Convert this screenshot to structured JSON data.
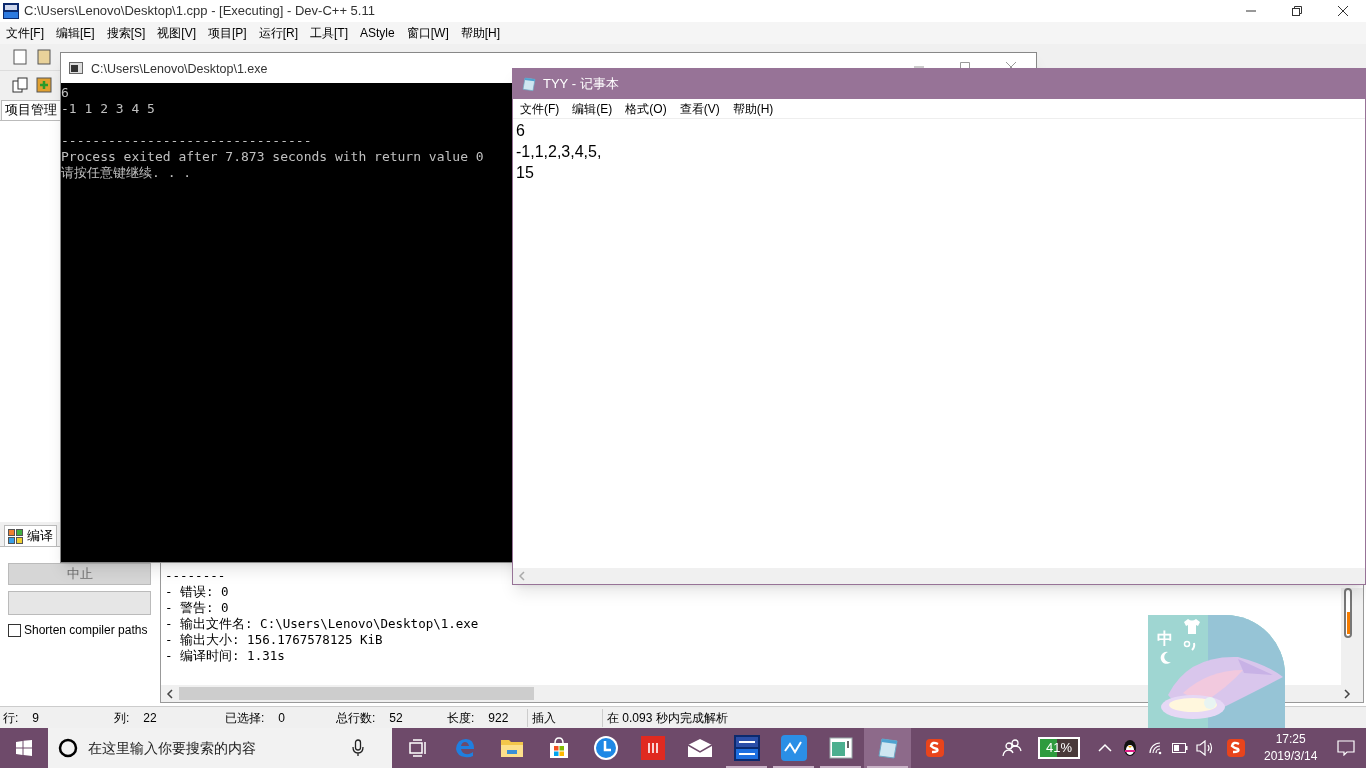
{
  "devcpp": {
    "title": "C:\\Users\\Lenovo\\Desktop\\1.cpp - [Executing] - Dev-C++ 5.11",
    "menu": [
      "文件[F]",
      "编辑[E]",
      "搜索[S]",
      "视图[V]",
      "项目[P]",
      "运行[R]",
      "工具[T]",
      "AStyle",
      "窗口[W]",
      "帮助[H]"
    ],
    "left_tab": "项目管理",
    "bottom_tab": "编译",
    "abort_button": {
      "label": "中止",
      "disabled": true
    },
    "progress": {
      "level": 0
    },
    "shorten_paths": {
      "label": "Shorten compiler paths",
      "checked": false
    },
    "log_lines": [
      "--------",
      "- 错误: 0",
      "- 警告: 0",
      "- 输出文件名: C:\\Users\\Lenovo\\Desktop\\1.exe",
      "- 输出大小: 156.1767578125 KiB",
      "- 编译时间: 1.31s"
    ],
    "status_fields": [
      {
        "label": "行:",
        "value": "9"
      },
      {
        "label": "列:",
        "value": "22"
      },
      {
        "label": "已选择:",
        "value": "0"
      },
      {
        "label": "总行数:",
        "value": "52"
      },
      {
        "label": "长度:",
        "value": "922"
      }
    ],
    "status_mode": "插入",
    "status_message": "在 0.093 秒内完成解析"
  },
  "console": {
    "title": "C:\\Users\\Lenovo\\Desktop\\1.exe",
    "output_lines": [
      "6",
      "-1 1 2 3 4 5"
    ],
    "footer_lines": [
      "--------------------------------",
      "Process exited after 7.873 seconds with return value 0",
      "请按任意键继续. . ."
    ]
  },
  "notepad": {
    "title": "TYY - 记事本",
    "menu": [
      "文件(F)",
      "编辑(E)",
      "格式(O)",
      "查看(V)",
      "帮助(H)"
    ],
    "lines": [
      "6",
      "-1,1,2,3,4,5,",
      "15"
    ]
  },
  "ime": {
    "mode": "中"
  },
  "taskbar": {
    "search_placeholder": "在这里输入你要搜索的内容",
    "apps": [
      {
        "kind": "taskview",
        "running": false,
        "selected": false
      },
      {
        "kind": "edge",
        "running": false,
        "selected": false
      },
      {
        "kind": "explorer",
        "running": false,
        "selected": false
      },
      {
        "kind": "store",
        "running": false,
        "selected": false
      },
      {
        "kind": "clock",
        "running": false,
        "selected": false
      },
      {
        "kind": "redapp",
        "running": false,
        "selected": false
      },
      {
        "kind": "mail",
        "running": false,
        "selected": false
      },
      {
        "kind": "devcpp",
        "running": true,
        "selected": false
      },
      {
        "kind": "chart",
        "running": true,
        "selected": false
      },
      {
        "kind": "window",
        "running": true,
        "selected": false
      },
      {
        "kind": "notepad",
        "running": true,
        "selected": true
      },
      {
        "kind": "sogou",
        "running": false,
        "selected": false
      }
    ],
    "battery": "41%",
    "time": "17:25",
    "date": "2019/3/14"
  }
}
